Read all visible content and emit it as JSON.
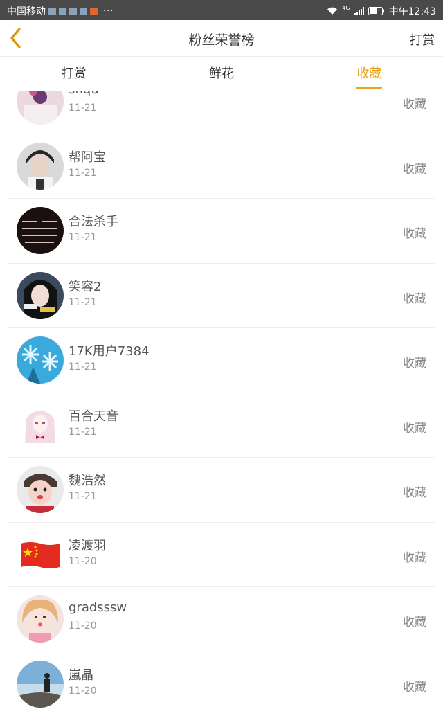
{
  "status_bar": {
    "carrier": "中国移动",
    "dots": "···",
    "network": "4G",
    "time": "中午12:43"
  },
  "header": {
    "title": "粉丝荣誉榜",
    "action_label": "打赏",
    "back_icon": "chevron-left-icon"
  },
  "tabs": [
    {
      "label": "打赏",
      "active": false
    },
    {
      "label": "鲜花",
      "active": false
    },
    {
      "label": "收藏",
      "active": true
    }
  ],
  "colors": {
    "accent": "#e8a21b",
    "status_bar": "#4a4a4a"
  },
  "list": [
    {
      "name": "snqu",
      "date": "11-21",
      "type": "收藏"
    },
    {
      "name": "帮阿宝",
      "date": "11-21",
      "type": "收藏"
    },
    {
      "name": "合法杀手",
      "date": "11-21",
      "type": "收藏"
    },
    {
      "name": "笑容2",
      "date": "11-21",
      "type": "收藏"
    },
    {
      "name": "17K用户7384",
      "date": "11-21",
      "type": "收藏"
    },
    {
      "name": "百合天音",
      "date": "11-21",
      "type": "收藏"
    },
    {
      "name": "魏浩然",
      "date": "11-21",
      "type": "收藏"
    },
    {
      "name": "凌渡羽",
      "date": "11-20",
      "type": "收藏"
    },
    {
      "name": "gradsssw",
      "date": "11-20",
      "type": "收藏"
    },
    {
      "name": "嵐晶",
      "date": "11-20",
      "type": "收藏"
    }
  ]
}
